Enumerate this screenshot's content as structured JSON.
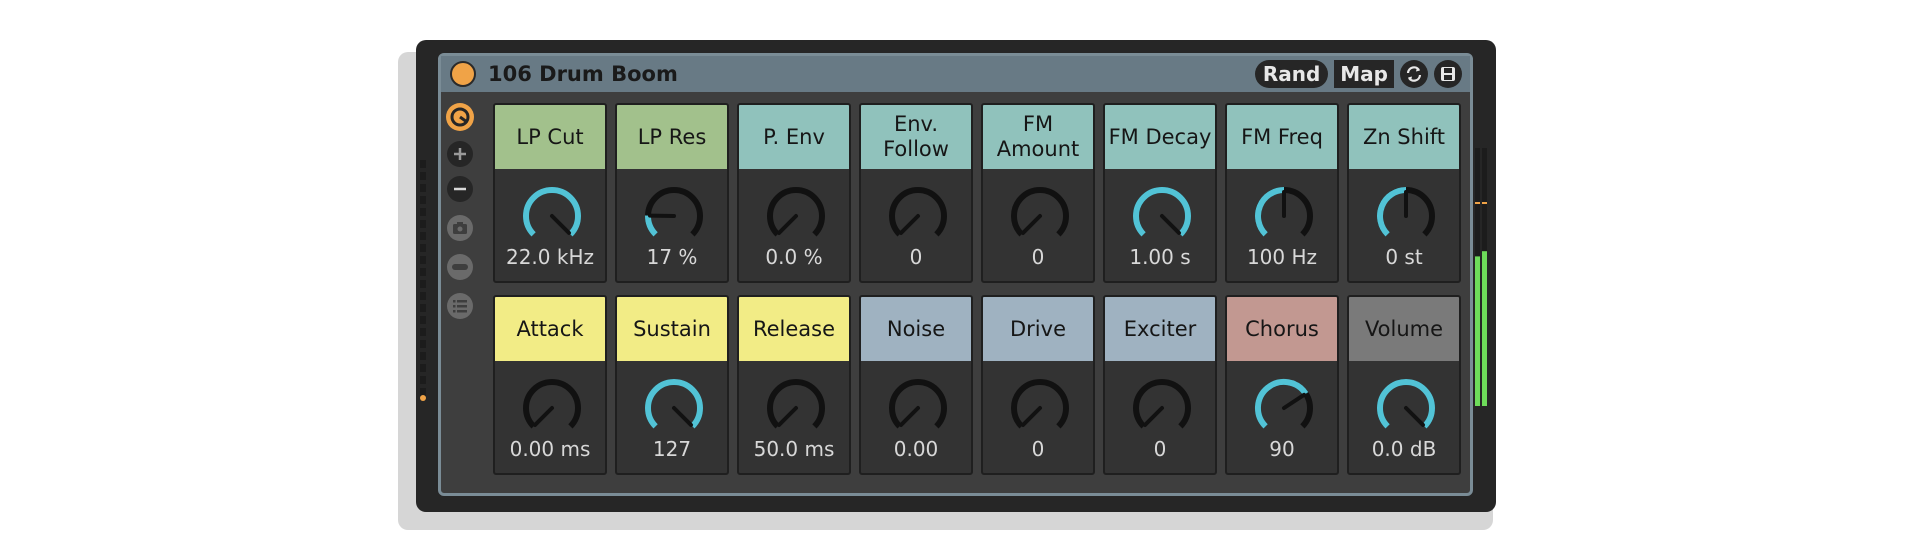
{
  "device": {
    "title": "106 Drum Boom",
    "rand_label": "Rand",
    "map_label": "Map"
  },
  "colors": {
    "accent": "#f0a347",
    "knob_arc": "#52c3d6",
    "meter_green": "#6edc5a"
  },
  "sidebar": {
    "icons": [
      "hotswap-icon",
      "plus-icon",
      "minus-icon",
      "camera-icon",
      "macro-lane-icon",
      "list-icon"
    ]
  },
  "macros": [
    {
      "label": "LP Cut",
      "value": "22.0 kHz",
      "color": "#a2c18c",
      "level": 1.0
    },
    {
      "label": "LP Res",
      "value": "17 %",
      "color": "#a2c18c",
      "level": 0.17
    },
    {
      "label": "P. Env",
      "value": "0.0 %",
      "color": "#90c2bc",
      "level": 0.0
    },
    {
      "label": "Env. Follow",
      "value": "0",
      "color": "#90c2bc",
      "level": 0.0
    },
    {
      "label": "FM Amount",
      "value": "0",
      "color": "#90c2bc",
      "level": 0.0
    },
    {
      "label": "FM Decay",
      "value": "1.00 s",
      "color": "#90c2bc",
      "level": 1.0
    },
    {
      "label": "FM Freq",
      "value": "100 Hz",
      "color": "#90c2bc",
      "level": 0.5
    },
    {
      "label": "Zn Shift",
      "value": "0 st",
      "color": "#90c2bc",
      "level": 0.5
    },
    {
      "label": "Attack",
      "value": "0.00 ms",
      "color": "#f2ec86",
      "level": 0.0
    },
    {
      "label": "Sustain",
      "value": "127",
      "color": "#f2ec86",
      "level": 1.0
    },
    {
      "label": "Release",
      "value": "50.0 ms",
      "color": "#f2ec86",
      "level": 0.0
    },
    {
      "label": "Noise",
      "value": "0.00",
      "color": "#9fb2c1",
      "level": 0.0
    },
    {
      "label": "Drive",
      "value": "0",
      "color": "#9fb2c1",
      "level": 0.0
    },
    {
      "label": "Exciter",
      "value": "0",
      "color": "#9fb2c1",
      "level": 0.0
    },
    {
      "label": "Chorus",
      "value": "90",
      "color": "#c29891",
      "level": 0.71
    },
    {
      "label": "Volume",
      "value": "0.0 dB",
      "color": "#7a7a7a",
      "level": 1.0
    }
  ],
  "meter": {
    "left_level": 0.58,
    "right_level": 0.6
  }
}
